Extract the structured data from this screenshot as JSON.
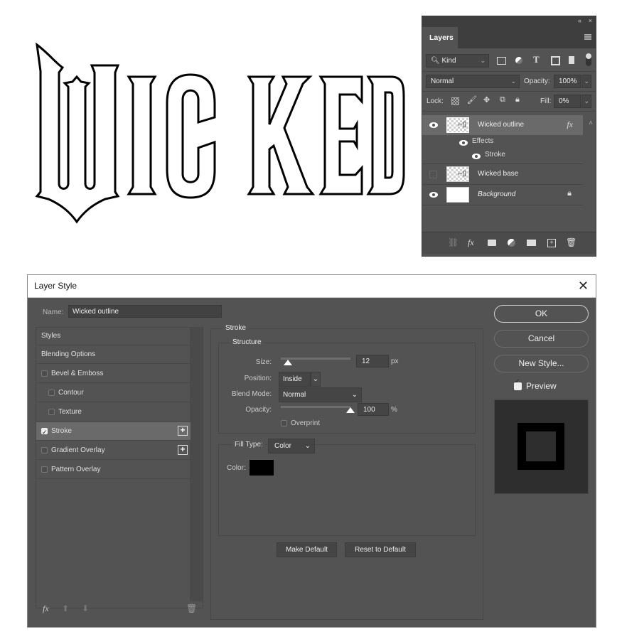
{
  "artwork": {
    "text": "WICKED",
    "style": "outline",
    "stroke_color": "#000000",
    "fill_color": "#ffffff"
  },
  "layers_panel": {
    "collapse_icon": "«",
    "close_icon": "×",
    "tab_label": "Layers",
    "filter": {
      "kind_label": "Kind",
      "icons": [
        "image-filter",
        "adjustment-filter",
        "type-filter",
        "shape-filter",
        "smart-object-filter"
      ]
    },
    "blend_mode": "Normal",
    "opacity_label": "Opacity:",
    "opacity_value": "100%",
    "lock_label": "Lock:",
    "fill_label": "Fill:",
    "fill_value": "0%",
    "layers": [
      {
        "name": "Wicked outline",
        "visible": true,
        "selected": true,
        "has_fx": true,
        "fx_label": "fx",
        "italic": false
      },
      {
        "name": "Wicked base",
        "visible": false,
        "selected": false,
        "has_fx": false,
        "italic": false
      },
      {
        "name": "Background",
        "visible": true,
        "selected": false,
        "locked": true,
        "italic": true
      }
    ],
    "effects_label": "Effects",
    "stroke_effect_label": "Stroke",
    "bottom_icons": [
      "link",
      "fx",
      "mask",
      "adjustment",
      "group",
      "new-layer",
      "delete"
    ]
  },
  "dialog": {
    "title": "Layer Style",
    "close_label": "✕",
    "name_label": "Name:",
    "name_value": "Wicked outline",
    "styles": [
      {
        "label": "Styles",
        "has_checkbox": false,
        "checked": false,
        "indent": false,
        "plus": false
      },
      {
        "label": "Blending Options",
        "has_checkbox": false,
        "checked": false,
        "indent": false,
        "plus": false
      },
      {
        "label": "Bevel & Emboss",
        "has_checkbox": true,
        "checked": false,
        "indent": false,
        "plus": false
      },
      {
        "label": "Contour",
        "has_checkbox": true,
        "checked": false,
        "indent": true,
        "plus": false
      },
      {
        "label": "Texture",
        "has_checkbox": true,
        "checked": false,
        "indent": true,
        "plus": false
      },
      {
        "label": "Stroke",
        "has_checkbox": true,
        "checked": true,
        "indent": false,
        "plus": true,
        "selected": true
      },
      {
        "label": "Gradient Overlay",
        "has_checkbox": true,
        "checked": false,
        "indent": false,
        "plus": true
      },
      {
        "label": "Pattern Overlay",
        "has_checkbox": true,
        "checked": false,
        "indent": false,
        "plus": false
      }
    ],
    "footer": {
      "fx_label": "fx",
      "up_label": "⬆",
      "down_label": "⬇",
      "delete_label": "🗑"
    },
    "stroke": {
      "section_title": "Stroke",
      "structure_title": "Structure",
      "size_label": "Size:",
      "size_value": "12",
      "size_unit": "px",
      "size_slider_fraction": 0.04,
      "position_label": "Position:",
      "position_value": "Inside",
      "blend_mode_label": "Blend Mode:",
      "blend_mode_value": "Normal",
      "opacity_label": "Opacity:",
      "opacity_value": "100",
      "opacity_unit": "%",
      "opacity_slider_fraction": 1.0,
      "overprint_label": "Overprint",
      "overprint_checked": false,
      "fill_type_label": "Fill Type:",
      "fill_type_value": "Color",
      "color_label": "Color:",
      "color_value": "#000000",
      "make_default_label": "Make Default",
      "reset_default_label": "Reset to Default"
    },
    "buttons": {
      "ok": "OK",
      "cancel": "Cancel",
      "new_style": "New Style..."
    },
    "preview_label": "Preview",
    "preview_checked": true
  }
}
